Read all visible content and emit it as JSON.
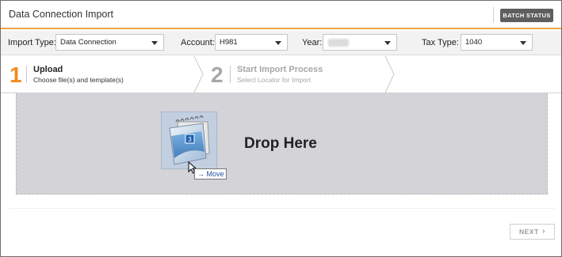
{
  "window": {
    "title": "Data Connection Import"
  },
  "header": {
    "batch_status_label": "BATCH STATUS"
  },
  "filters": {
    "import_type": {
      "label": "Import Type:",
      "value": "Data Connection"
    },
    "account": {
      "label": "Account:",
      "value": "H981"
    },
    "year": {
      "label": "Year:",
      "value": ""
    },
    "tax_type": {
      "label": "Tax Type:",
      "value": "1040"
    }
  },
  "steps": [
    {
      "number": "1",
      "title": "Upload",
      "subtitle": "Choose file(s) and template(s)",
      "active": true
    },
    {
      "number": "2",
      "title": "Start Import Process",
      "subtitle": "Select Locator for Import",
      "active": false
    }
  ],
  "dropzone": {
    "label": "Drop Here",
    "drag_icon": "notepad-icon",
    "drag_icon_badge": "3",
    "cursor_tooltip": "Move"
  },
  "footer": {
    "next_label": "NEXT"
  },
  "colors": {
    "accent": "#f0a24a",
    "active_step_number": "#f08a1e",
    "inactive_step": "#a7a7a7",
    "dropzone_bg": "#d3d3d8",
    "batch_button_bg": "#5e5e5e"
  }
}
